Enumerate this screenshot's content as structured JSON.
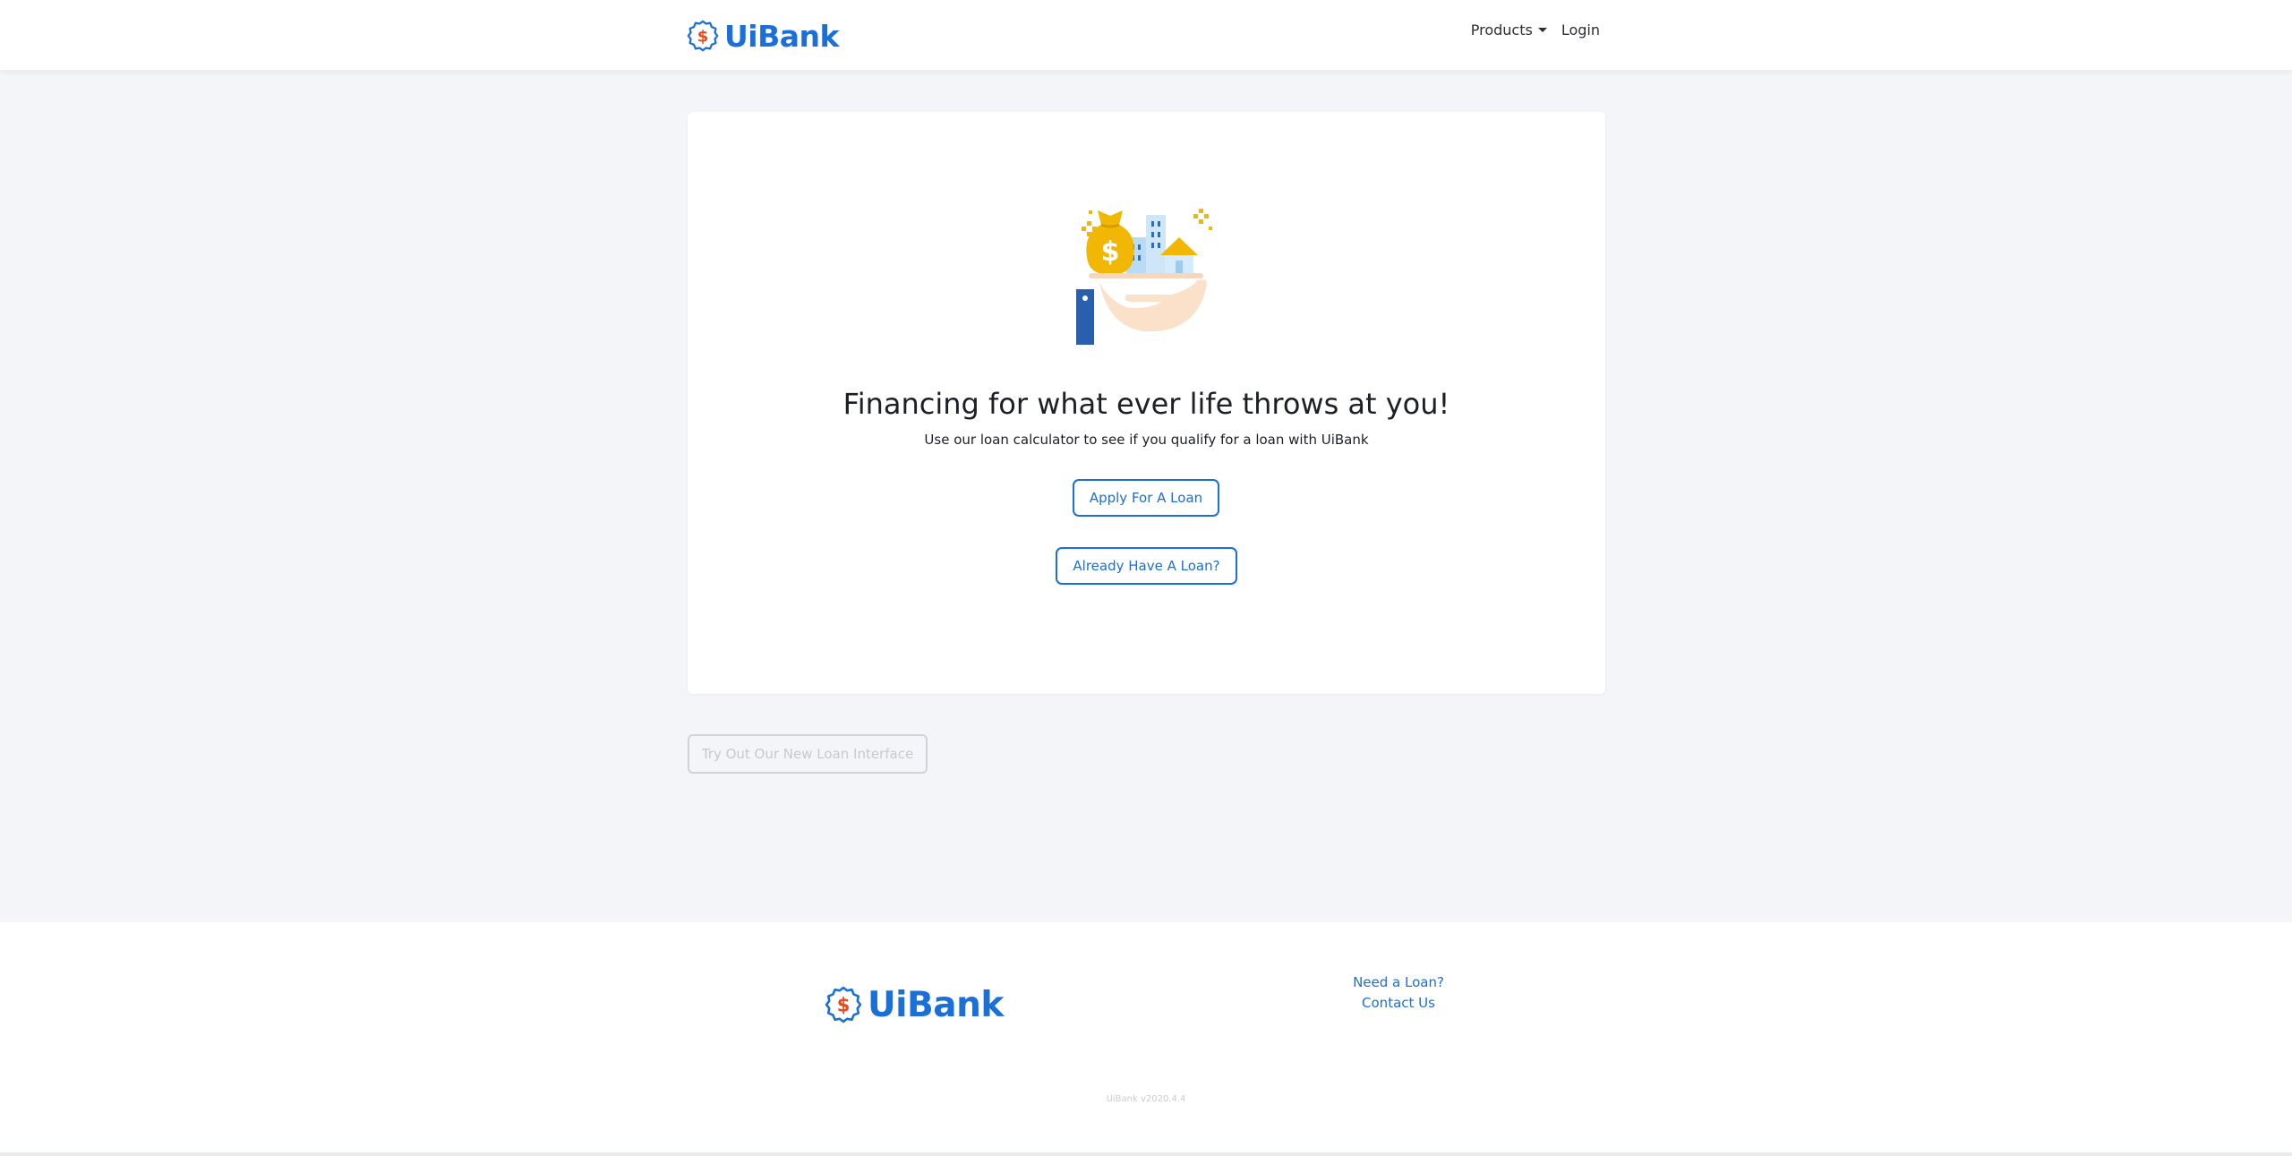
{
  "nav": {
    "brand": "UiBank",
    "logo_icon": "dollar-badge-icon",
    "products_label": "Products",
    "login_label": "Login"
  },
  "hero": {
    "illustration": "money-bag-buildings-hand-icon",
    "title": "Financing for what ever life throws at you!",
    "subtitle": "Use our loan calculator to see if you qualify for a loan with UiBank",
    "apply_button": "Apply For A Loan",
    "already_button": "Already Have A Loan?"
  },
  "new_interface_button": "Try Out Our New Loan Interface",
  "footer": {
    "brand": "UiBank",
    "links": [
      "Need a Loan?",
      "Contact Us"
    ],
    "version": "UiBank v2020.4.4"
  },
  "colors": {
    "accent": "#1a6fd8",
    "logo_dollar": "#e8491d",
    "page_background": "#f4f5f8",
    "disabled": "#cfd2d6"
  }
}
